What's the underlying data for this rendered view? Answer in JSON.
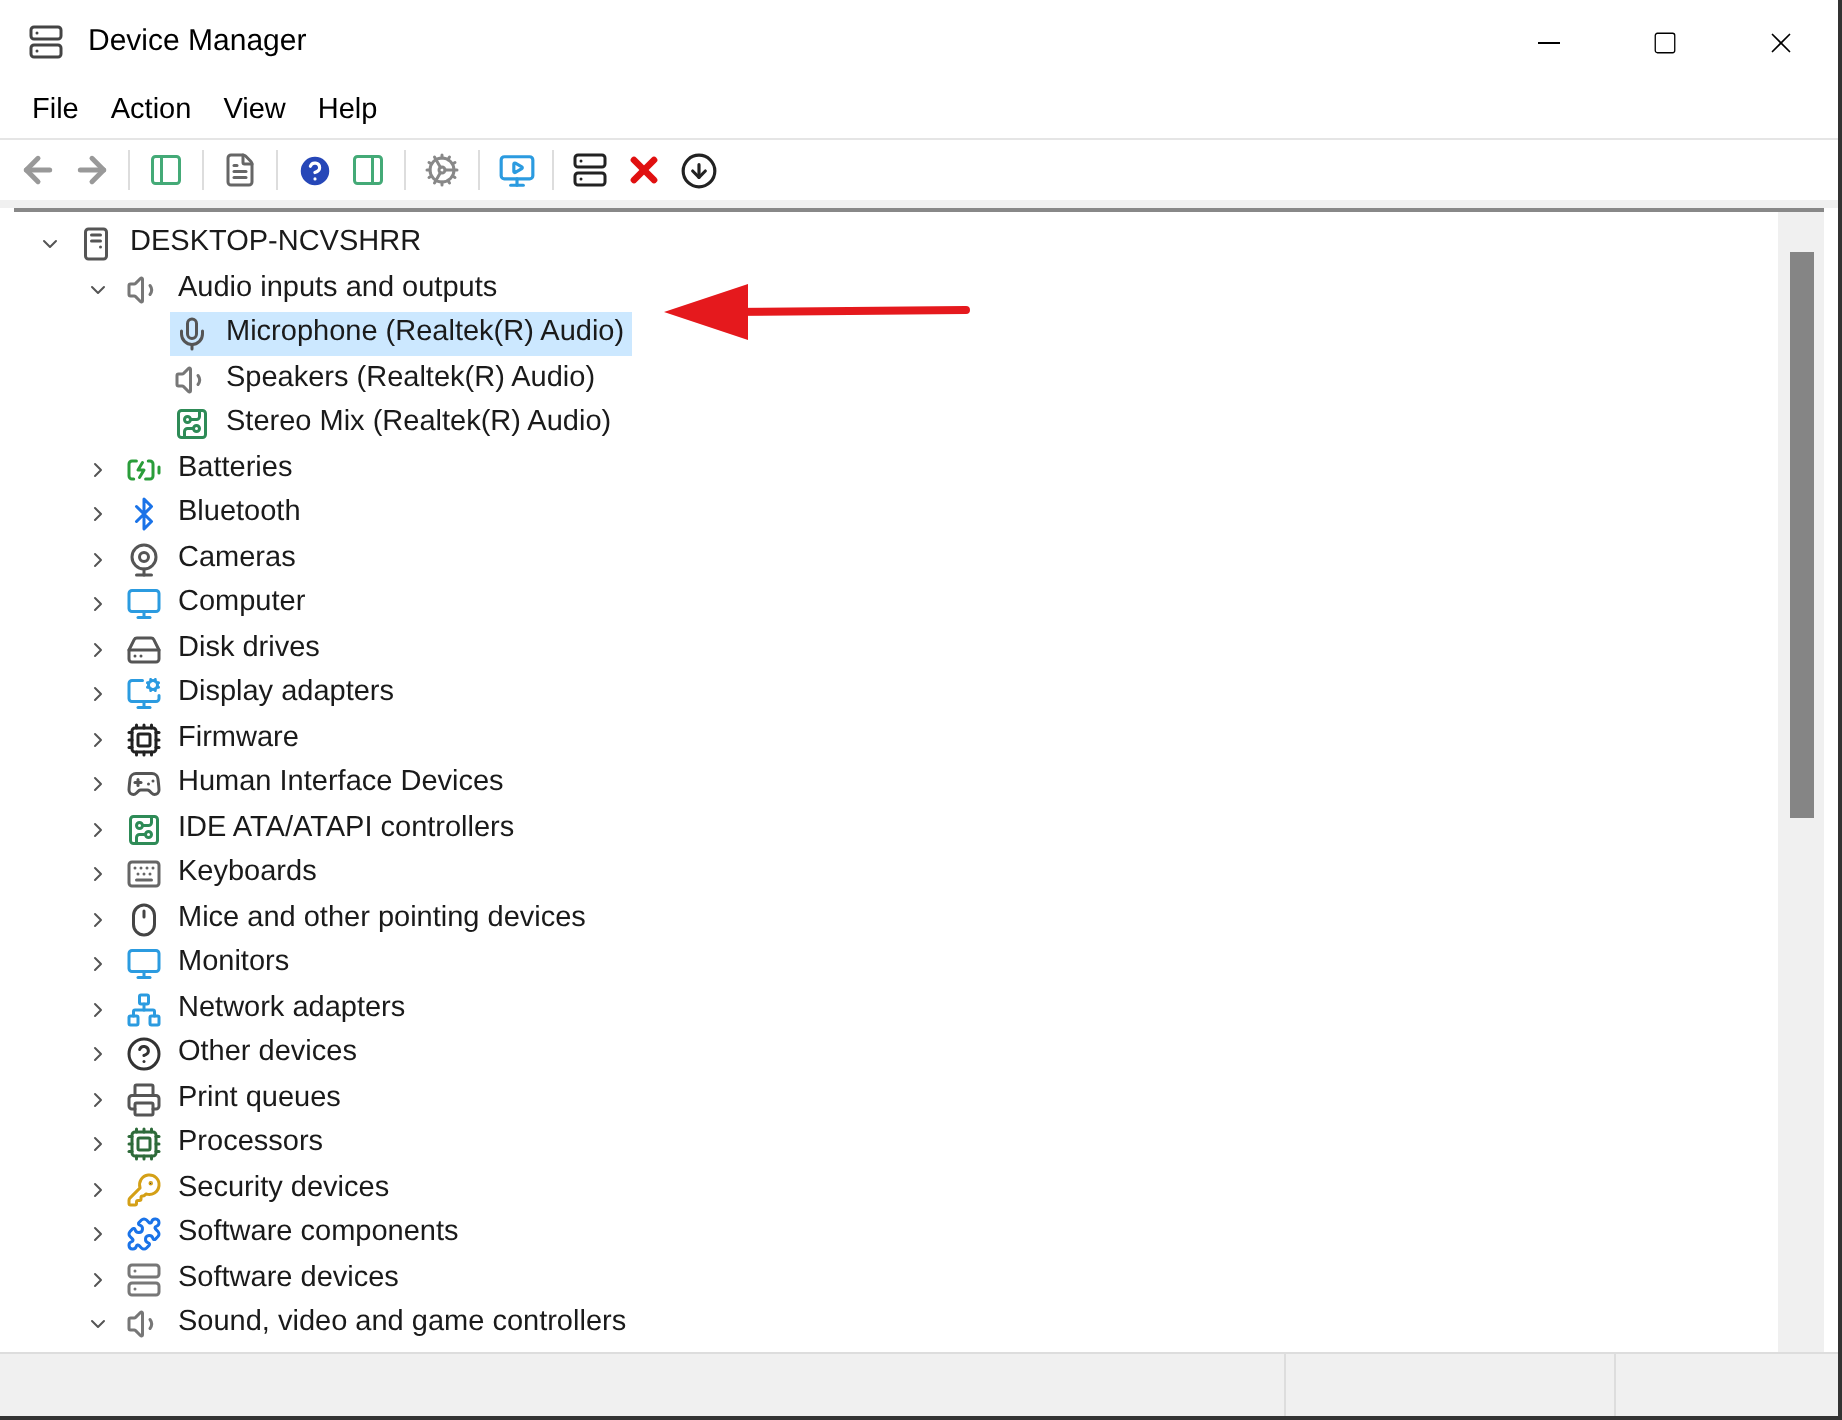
{
  "window": {
    "title": "Device Manager"
  },
  "menu": [
    "File",
    "Action",
    "View",
    "Help"
  ],
  "tree": [
    {
      "label": "DESKTOP-NCVSHRR",
      "kind": "computer",
      "expanded": true,
      "selected": false,
      "children": [
        {
          "label": "Audio inputs and outputs",
          "kind": "speaker",
          "expanded": true,
          "selected": false,
          "children": [
            {
              "label": "Microphone (Realtek(R) Audio)",
              "kind": "microphone",
              "selected": true
            },
            {
              "label": "Speakers (Realtek(R) Audio)",
              "kind": "speaker",
              "selected": false
            },
            {
              "label": "Stereo Mix (Realtek(R) Audio)",
              "kind": "card",
              "selected": false
            }
          ]
        },
        {
          "label": "Batteries",
          "kind": "battery",
          "expanded": false,
          "selected": false
        },
        {
          "label": "Bluetooth",
          "kind": "bluetooth",
          "expanded": false,
          "selected": false
        },
        {
          "label": "Cameras",
          "kind": "camera",
          "expanded": false,
          "selected": false
        },
        {
          "label": "Computer",
          "kind": "monitor",
          "expanded": false,
          "selected": false
        },
        {
          "label": "Disk drives",
          "kind": "disk",
          "expanded": false,
          "selected": false
        },
        {
          "label": "Display adapters",
          "kind": "display",
          "expanded": false,
          "selected": false
        },
        {
          "label": "Firmware",
          "kind": "chip",
          "expanded": false,
          "selected": false
        },
        {
          "label": "Human Interface Devices",
          "kind": "hid",
          "expanded": false,
          "selected": false
        },
        {
          "label": "IDE ATA/ATAPI controllers",
          "kind": "card",
          "expanded": false,
          "selected": false
        },
        {
          "label": "Keyboards",
          "kind": "keyboard",
          "expanded": false,
          "selected": false
        },
        {
          "label": "Mice and other pointing devices",
          "kind": "mouse",
          "expanded": false,
          "selected": false
        },
        {
          "label": "Monitors",
          "kind": "monitor",
          "expanded": false,
          "selected": false
        },
        {
          "label": "Network adapters",
          "kind": "network",
          "expanded": false,
          "selected": false
        },
        {
          "label": "Other devices",
          "kind": "other",
          "expanded": false,
          "selected": false
        },
        {
          "label": "Print queues",
          "kind": "printer",
          "expanded": false,
          "selected": false
        },
        {
          "label": "Processors",
          "kind": "processor",
          "expanded": false,
          "selected": false
        },
        {
          "label": "Security devices",
          "kind": "security",
          "expanded": false,
          "selected": false
        },
        {
          "label": "Software components",
          "kind": "component",
          "expanded": false,
          "selected": false
        },
        {
          "label": "Software devices",
          "kind": "softdevice",
          "expanded": false,
          "selected": false
        },
        {
          "label": "Sound, video and game controllers",
          "kind": "speaker",
          "expanded": true,
          "selected": false
        }
      ]
    }
  ]
}
